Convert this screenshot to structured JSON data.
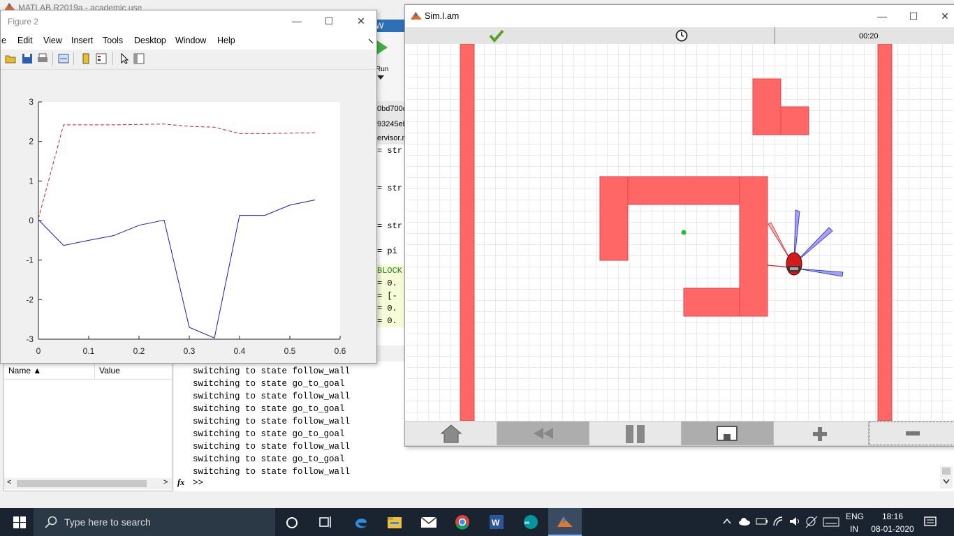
{
  "matlab": {
    "title": "MATLAB R2019a - academic use",
    "toolstrip_fragments": [
      "W",
      "Run"
    ],
    "editor_fragments": [
      "0bd700c",
      "93245eb",
      "ervisor.m",
      "= str",
      "= str",
      "= str",
      "= pi",
      "BLOCK",
      "= 0.",
      "= [-",
      "= 0.",
      "= 0."
    ]
  },
  "workspace": {
    "columns": [
      "Name ▲",
      "Value"
    ]
  },
  "command_window": {
    "lines": [
      "switching to state follow_wall",
      "switching to state go_to_goal",
      "switching to state follow_wall",
      "switching to state go_to_goal",
      "switching to state follow_wall",
      "switching to state go_to_goal",
      "switching to state follow_wall",
      "switching to state go_to_goal",
      "switching to state follow_wall"
    ],
    "prompt_symbol": "fx",
    "prompt": ">>"
  },
  "figure": {
    "title": "Figure 2",
    "menu": [
      "e",
      "Edit",
      "View",
      "Insert",
      "Tools",
      "Desktop",
      "Window",
      "Help"
    ],
    "window_buttons": [
      "—",
      "☐",
      "✕"
    ]
  },
  "chart_data": {
    "type": "line",
    "xlim": [
      0,
      0.6
    ],
    "ylim": [
      -3,
      3
    ],
    "xticks": [
      "0",
      "0.1",
      "0.2",
      "0.3",
      "0.4",
      "0.5",
      "0.6"
    ],
    "yticks": [
      "3",
      "2",
      "1",
      "0",
      "-1",
      "-2",
      "-3"
    ],
    "grid": false,
    "series": [
      {
        "style": "dashed",
        "color": "#d62020",
        "x": [
          0,
          0.05,
          0.1,
          0.15,
          0.2,
          0.25,
          0.3,
          0.35,
          0.4,
          0.45,
          0.5,
          0.55
        ],
        "y": [
          0.05,
          2.42,
          2.42,
          2.42,
          2.43,
          2.44,
          2.38,
          2.36,
          2.2,
          2.2,
          2.21,
          2.22
        ]
      },
      {
        "style": "solid",
        "color": "#1a1ab0",
        "x": [
          0,
          0.05,
          0.1,
          0.15,
          0.2,
          0.25,
          0.3,
          0.35,
          0.4,
          0.45,
          0.5,
          0.55
        ],
        "y": [
          0.02,
          -0.63,
          -0.5,
          -0.38,
          -0.12,
          0.01,
          -2.7,
          -2.97,
          0.13,
          0.13,
          0.39,
          0.52
        ]
      }
    ]
  },
  "sim": {
    "title": "Sim.I.am",
    "time": "00:20",
    "window_buttons": [
      "—",
      "☐",
      "✕"
    ],
    "colors": {
      "obstacle": "#ff6666",
      "goal": "#22c02a",
      "robot": "#d41a1a",
      "ir_sensor": "#5a5aff"
    }
  },
  "taskbar": {
    "search_placeholder": "Type here to search",
    "lang_top": "ENG",
    "lang_bottom": "IN",
    "time": "18:16",
    "date": "08-01-2020"
  }
}
